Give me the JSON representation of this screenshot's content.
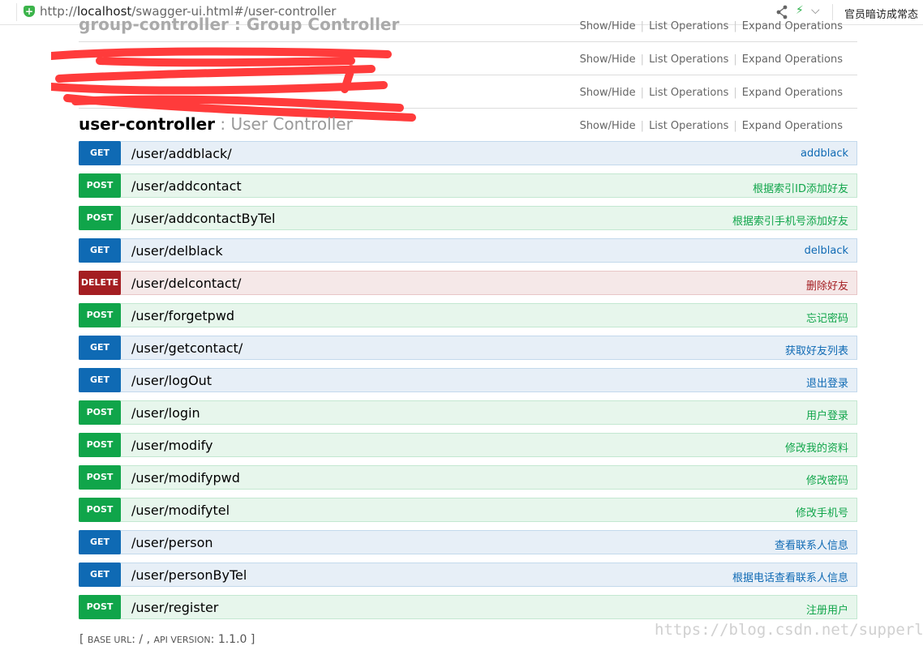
{
  "browser": {
    "url_prefix": "http://",
    "url_host": "localhost",
    "url_path": "/swagger-ui.html#/user-controller",
    "news_text": "官员暗访成常态"
  },
  "links": {
    "show_hide": "Show/Hide",
    "list_operations": "List Operations",
    "expand_operations": "Expand Operations"
  },
  "resources": [
    {
      "name": "group-controller",
      "title": "Group Controller"
    },
    {
      "name": "",
      "title": ""
    },
    {
      "name": "",
      "title": ""
    },
    {
      "name": "user-controller",
      "title": "User Controller"
    }
  ],
  "operations": [
    {
      "method": "GET",
      "path": "/user/addblack/",
      "summary": "addblack"
    },
    {
      "method": "POST",
      "path": "/user/addcontact",
      "summary": "根据索引ID添加好友"
    },
    {
      "method": "POST",
      "path": "/user/addcontactByTel",
      "summary": "根据索引手机号添加好友"
    },
    {
      "method": "GET",
      "path": "/user/delblack",
      "summary": "delblack"
    },
    {
      "method": "DELETE",
      "path": "/user/delcontact/",
      "summary": "删除好友"
    },
    {
      "method": "POST",
      "path": "/user/forgetpwd",
      "summary": "忘记密码"
    },
    {
      "method": "GET",
      "path": "/user/getcontact/",
      "summary": "获取好友列表"
    },
    {
      "method": "GET",
      "path": "/user/logOut",
      "summary": "退出登录"
    },
    {
      "method": "POST",
      "path": "/user/login",
      "summary": "用户登录"
    },
    {
      "method": "POST",
      "path": "/user/modify",
      "summary": "修改我的资料"
    },
    {
      "method": "POST",
      "path": "/user/modifypwd",
      "summary": "修改密码"
    },
    {
      "method": "POST",
      "path": "/user/modifytel",
      "summary": "修改手机号"
    },
    {
      "method": "GET",
      "path": "/user/person",
      "summary": "查看联系人信息"
    },
    {
      "method": "GET",
      "path": "/user/personByTel",
      "summary": "根据电话查看联系人信息"
    },
    {
      "method": "POST",
      "path": "/user/register",
      "summary": "注册用户"
    }
  ],
  "footer": {
    "base_url_label": "BASE URL",
    "base_url_value": "/",
    "api_version_label": "API VERSION",
    "api_version_value": "1.1.0"
  },
  "watermark": "https://blog.csdn.net/supperling",
  "colors": {
    "get": "#0f6ab4",
    "post": "#10a54a",
    "delete": "#a41e22"
  }
}
